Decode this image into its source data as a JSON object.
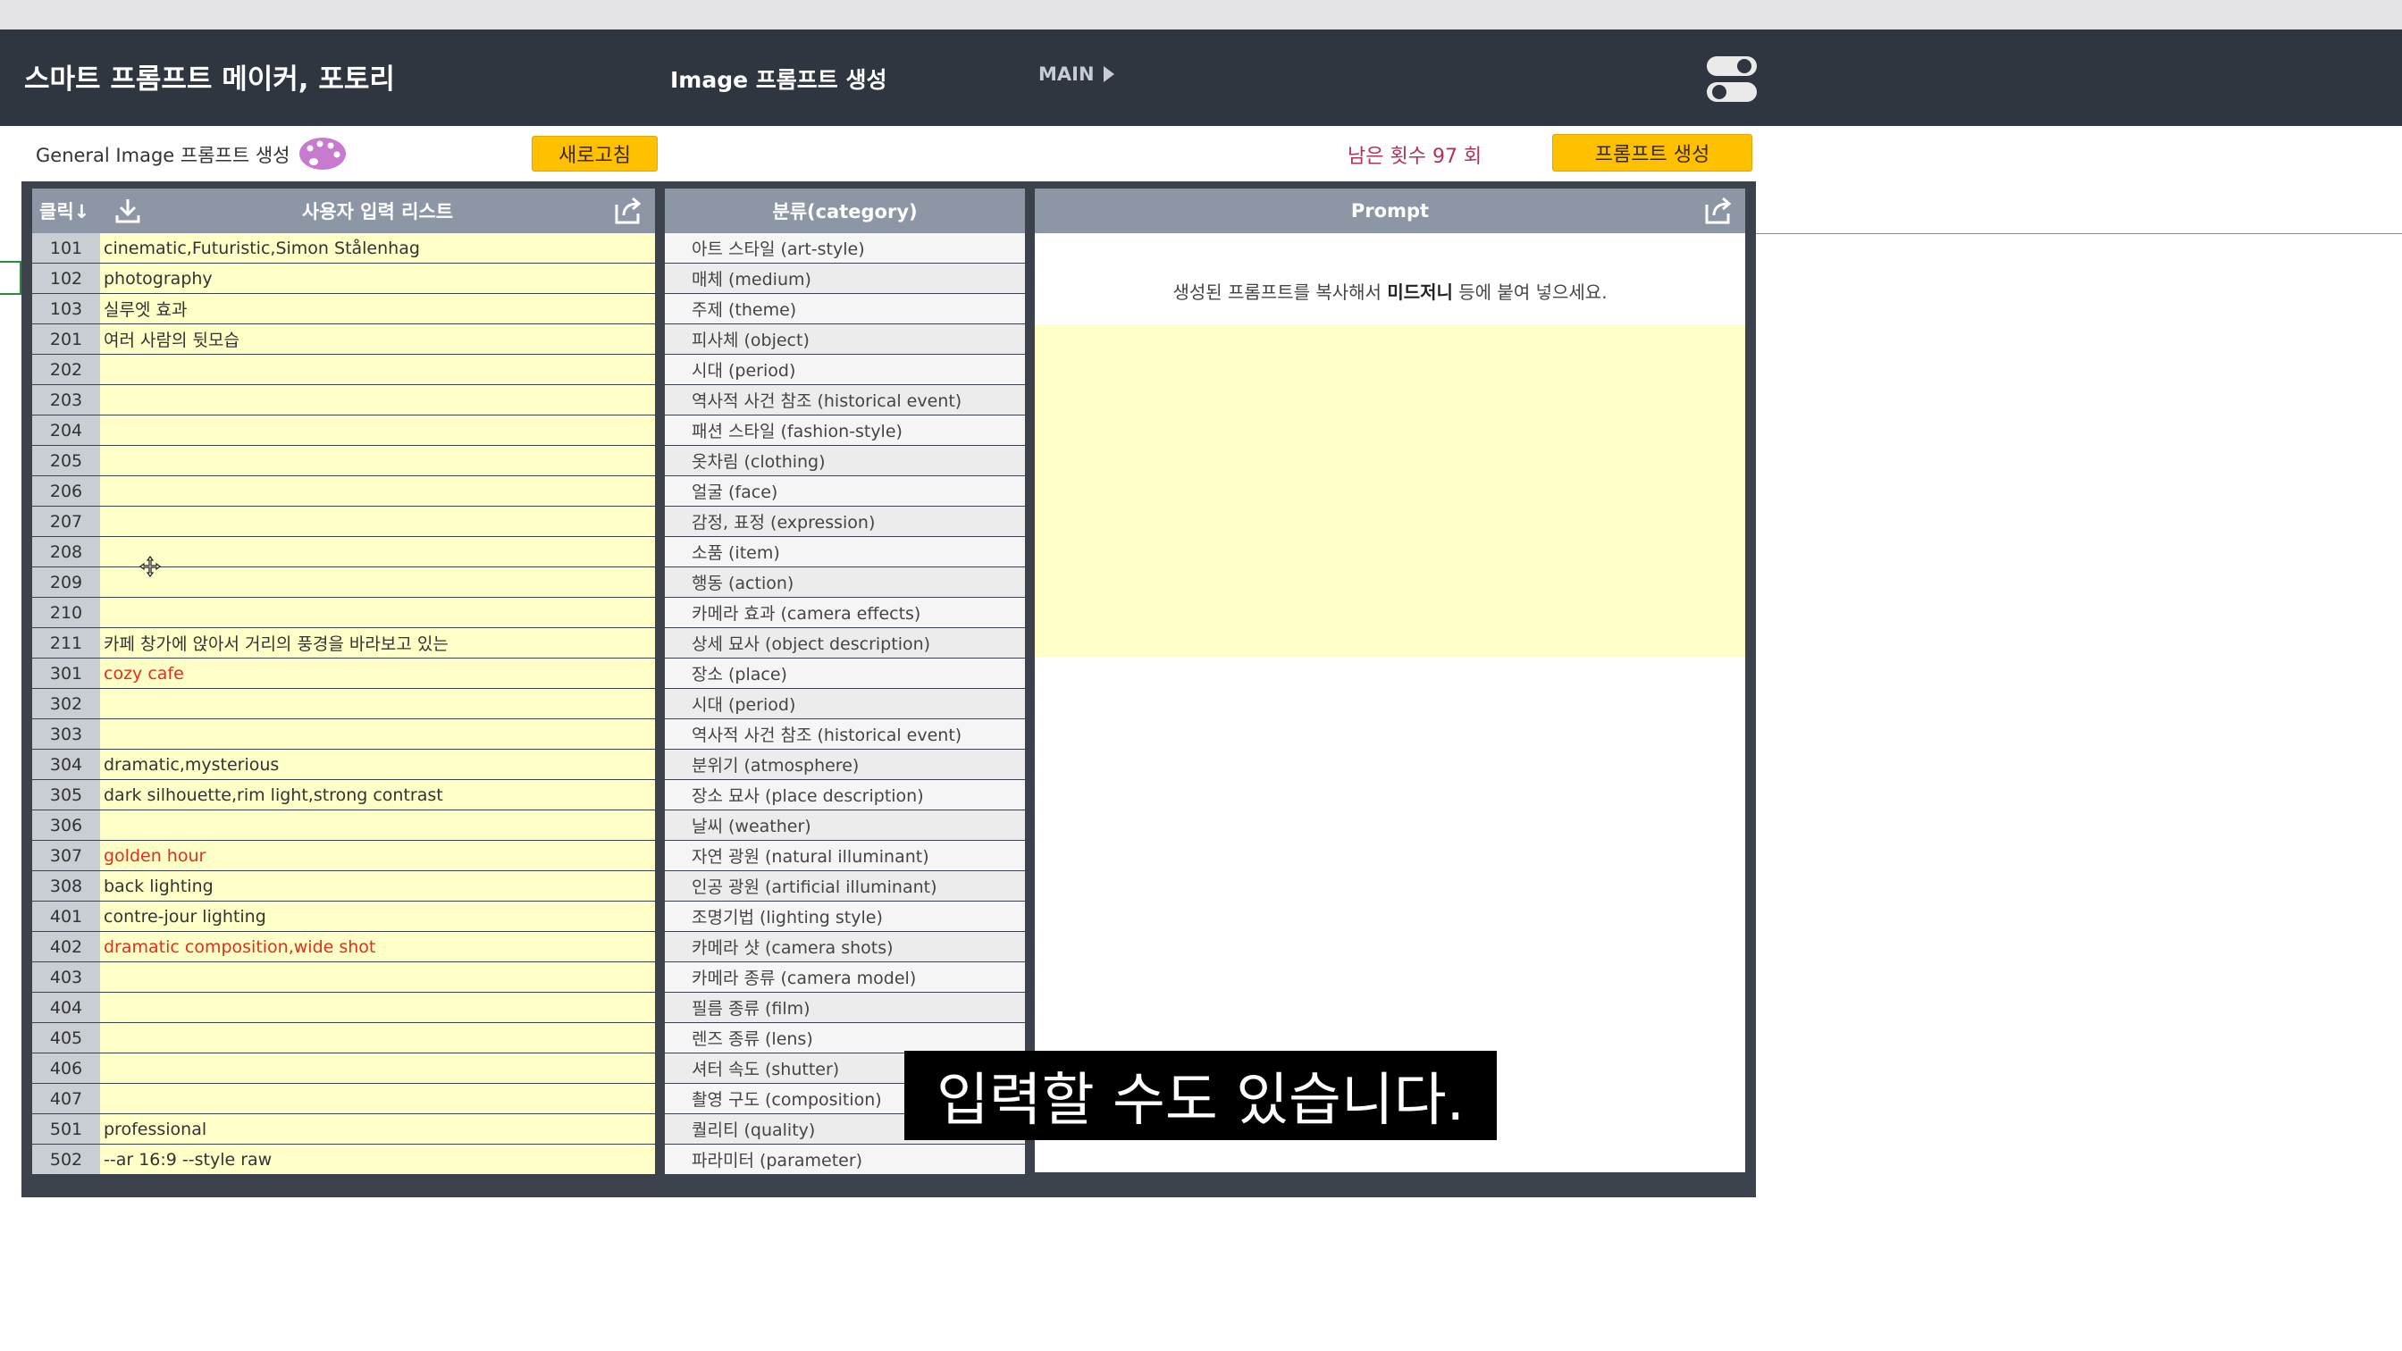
{
  "header": {
    "app_title": "스마트 프롬프트 메이커, 포토리",
    "section_title": "Image 프롬프트 생성",
    "main_link": "MAIN"
  },
  "subbar": {
    "label": "General Image 프롬프트 생성",
    "refresh_label": "새로고침",
    "remaining": "남은 횟수 97 회",
    "generate_label": "프롬프트 생성"
  },
  "table": {
    "col_click": "클릭↓",
    "col_input": "사용자 입력 리스트",
    "col_category": "분류(category)",
    "col_prompt": "Prompt",
    "rows": [
      {
        "num": "101",
        "input": "cinematic,Futuristic,Simon Stålenhag",
        "category": "아트 스타일 (art-style)"
      },
      {
        "num": "102",
        "input": "photography",
        "category": "매체 (medium)"
      },
      {
        "num": "103",
        "input": "실루엣 효과",
        "category": "주제 (theme)"
      },
      {
        "num": "201",
        "input": "여러 사람의 뒷모습",
        "category": "피사체 (object)"
      },
      {
        "num": "202",
        "input": "",
        "category": "시대 (period)"
      },
      {
        "num": "203",
        "input": "",
        "category": "역사적 사건 참조 (historical event)"
      },
      {
        "num": "204",
        "input": "",
        "category": "패션 스타일 (fashion-style)"
      },
      {
        "num": "205",
        "input": "",
        "category": "옷차림 (clothing)"
      },
      {
        "num": "206",
        "input": "",
        "category": "얼굴 (face)"
      },
      {
        "num": "207",
        "input": "",
        "category": "감정, 표정 (expression)"
      },
      {
        "num": "208",
        "input": "",
        "category": "소품 (item)"
      },
      {
        "num": "209",
        "input": "",
        "category": "행동 (action)"
      },
      {
        "num": "210",
        "input": "",
        "category": "카메라 효과 (camera effects)"
      },
      {
        "num": "211",
        "input": "카페 창가에 앉아서 거리의 풍경을 바라보고 있는",
        "category": "상세 묘사 (object description)"
      },
      {
        "num": "301",
        "input": "cozy cafe",
        "category": "장소 (place)",
        "red": true
      },
      {
        "num": "302",
        "input": "",
        "category": "시대 (period)"
      },
      {
        "num": "303",
        "input": "",
        "category": "역사적 사건 참조 (historical event)"
      },
      {
        "num": "304",
        "input": "dramatic,mysterious",
        "category": "분위기 (atmosphere)"
      },
      {
        "num": "305",
        "input": "dark silhouette,rim light,strong contrast",
        "category": "장소 묘사 (place description)"
      },
      {
        "num": "306",
        "input": "",
        "category": "날씨 (weather)"
      },
      {
        "num": "307",
        "input": "golden hour",
        "category": "자연 광원 (natural illuminant)",
        "red": true
      },
      {
        "num": "308",
        "input": "back lighting",
        "category": "인공 광원 (artificial illuminant)"
      },
      {
        "num": "401",
        "input": "contre-jour lighting",
        "category": "조명기법 (lighting style)"
      },
      {
        "num": "402",
        "input": "dramatic composition,wide shot",
        "category": "카메라 샷 (camera shots)",
        "red": true
      },
      {
        "num": "403",
        "input": "",
        "category": "카메라 종류 (camera model)"
      },
      {
        "num": "404",
        "input": "",
        "category": "필름 종류 (film)"
      },
      {
        "num": "405",
        "input": "",
        "category": "렌즈 종류 (lens)"
      },
      {
        "num": "406",
        "input": "",
        "category": "셔터 속도 (shutter)"
      },
      {
        "num": "407",
        "input": "",
        "category": "촬영 구도 (composition)"
      },
      {
        "num": "501",
        "input": "professional",
        "category": "퀄리티 (quality)"
      },
      {
        "num": "502",
        "input": "--ar 16:9 --style raw",
        "category": "파라미터 (parameter)"
      }
    ]
  },
  "prompt": {
    "hint_before": "생성된 프롬프트를 복사해서 ",
    "hint_bold": "미드저니",
    "hint_after": " 등에 붙여 넣으세요."
  },
  "subtitle_text": "입력할 수도 있습니다.",
  "colors": {
    "header_bg": "#2f3640",
    "accent_button": "#ffc000",
    "input_cell_bg": "#ffffc8",
    "table_header_bg": "#8d96a4",
    "highlight_text": "#e03020"
  }
}
